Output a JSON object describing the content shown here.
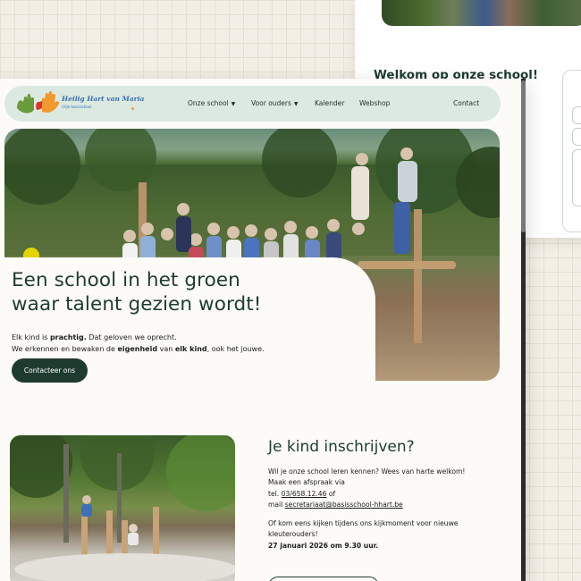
{
  "back_page": {
    "welcome_title": "Welkom op onze school!"
  },
  "site": {
    "logo_name": "Heilig Hart van Maria",
    "logo_sub": "Vrije basisschool"
  },
  "nav": {
    "items": [
      {
        "label": "Onze school",
        "dropdown": true
      },
      {
        "label": "Voor ouders",
        "dropdown": true
      },
      {
        "label": "Kalender",
        "dropdown": false
      },
      {
        "label": "Webshop",
        "dropdown": false
      }
    ],
    "contact_label": "Contact"
  },
  "hero": {
    "title_line1": "Een school in het groen",
    "title_line2": "waar talent gezien wordt!",
    "line1_a": "Elk kind is ",
    "line1_b": "prachtig.",
    "line1_c": " Dat geloven we oprecht.",
    "line2_a": "We erkennen en bewaken de ",
    "line2_b": "eigenheid",
    "line2_c": " van ",
    "line2_d": "elk kind",
    "line2_e": ", ook het jouwe.",
    "cta_label": "Contacteer ons"
  },
  "enroll": {
    "title": "Je kind inschrijven?",
    "p1": "Wil je onze school leren kennen? Wees van harte welkom!",
    "p2": "Maak een afspraak via",
    "tel_prefix": "tel. ",
    "tel": "03/658.12.46",
    "tel_suffix": " of",
    "mail_prefix": "mail ",
    "mail": "secretariaat@basisschool-hhart.be",
    "p3a": "Of kom eens kijken tijdens ons kijkmoment voor nieuwe",
    "p3b": "kleuterouders!",
    "date": "27 januari 2026 om 9.30 uur."
  },
  "colors": {
    "brand_dark": "#1f3b30",
    "nav_bg": "#dce9e1",
    "page_bg": "#f4efe6"
  }
}
